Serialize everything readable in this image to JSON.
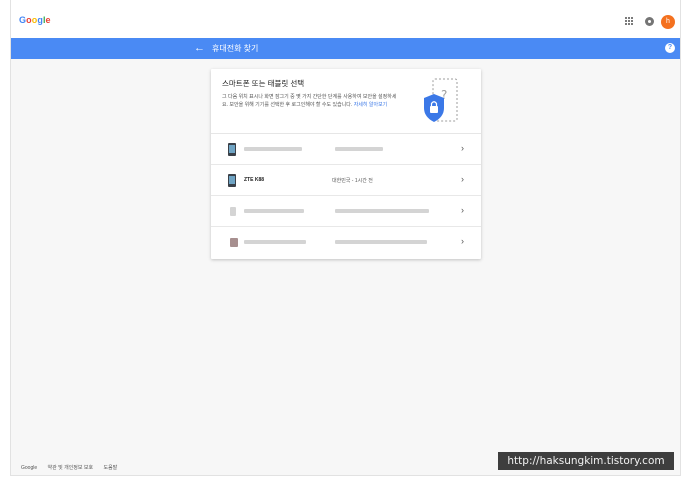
{
  "header": {
    "logo": {
      "g1": "G",
      "o1": "o",
      "o2": "o",
      "g2": "g",
      "l": "l",
      "e": "e"
    },
    "avatar_initial": "h"
  },
  "bluebar": {
    "title": "휴대전화 찾기",
    "color": "#4a8af4"
  },
  "card": {
    "title": "스마트폰 또는 태블릿 선택",
    "description": "그 다음 위치 표시나 화면 잠그기 중 몇 가지 간단한 단계를 사용하여 보안을 설정하세요. 보안을 위해 기기를 선택한 후 로그인해야 할 수도 있습니다.",
    "learn_more": "자세히 알아보기"
  },
  "devices": [
    {
      "name": "",
      "location": ""
    },
    {
      "name": "ZTE K88",
      "location": "대한민국 - 1시간 전"
    },
    {
      "name": "",
      "location": ""
    },
    {
      "name": "",
      "location": ""
    }
  ],
  "footer": {
    "brand": "Google",
    "terms": "약관 및 개인정보 보호",
    "feedback": "도움말"
  },
  "watermark": "http://haksungkim.tistory.com",
  "colors": {
    "accent": "#4a8af4",
    "avatar": "#f4711f",
    "shield": "#3b78e7"
  }
}
